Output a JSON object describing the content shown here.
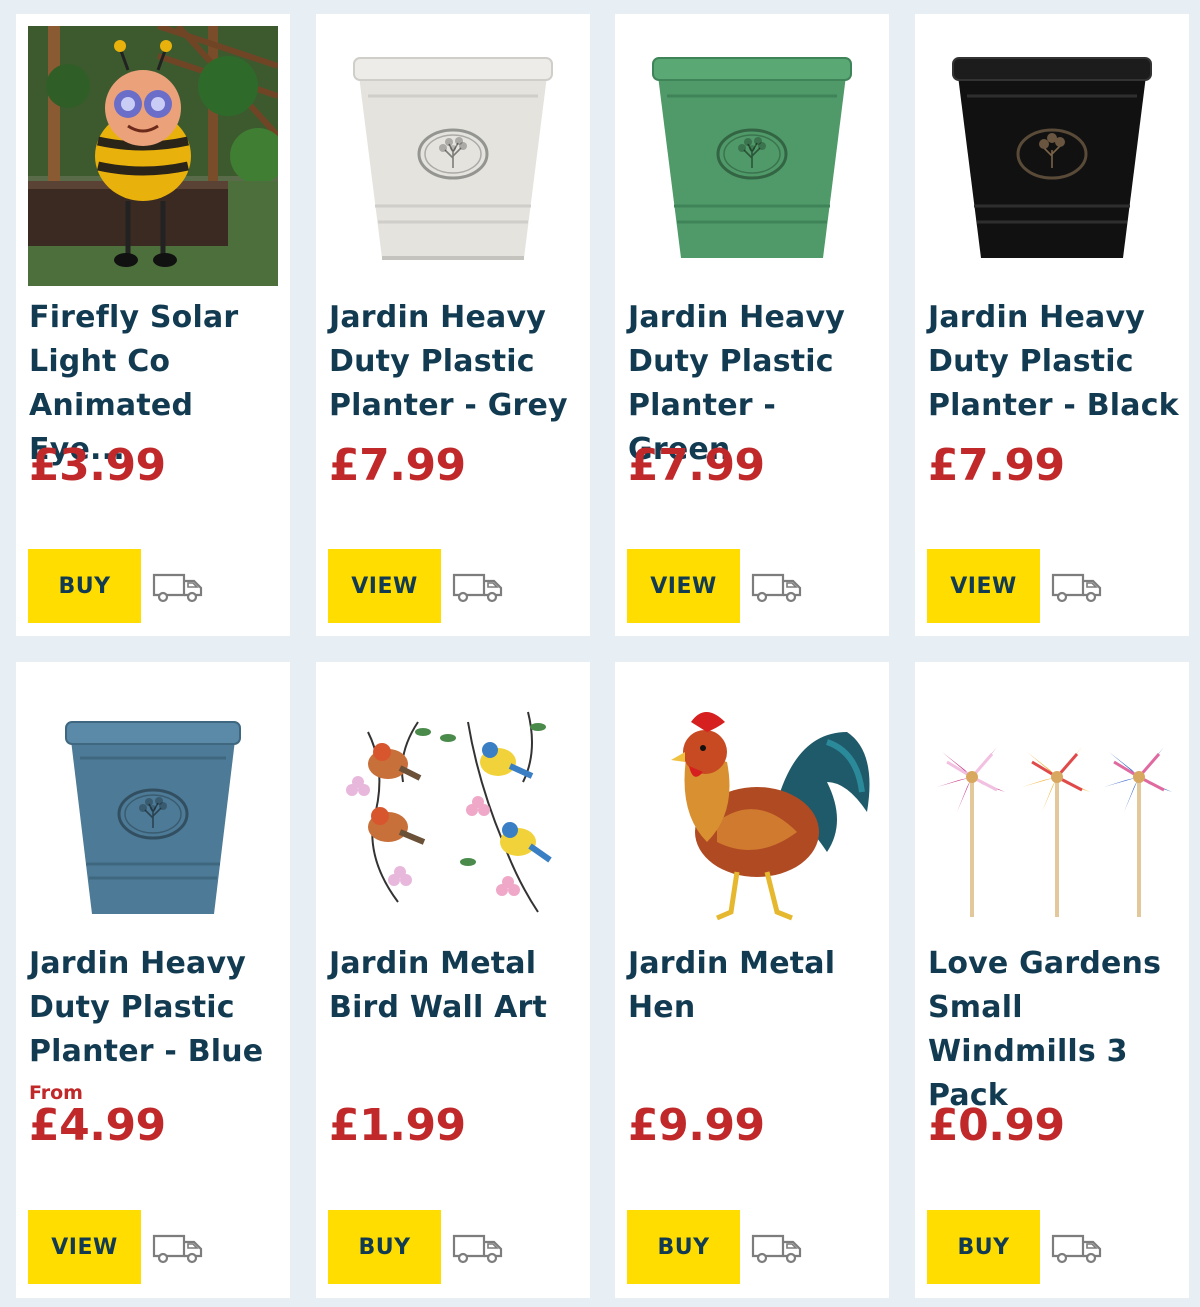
{
  "products": [
    {
      "title": "Firefly Solar Light Co Animated Eye...",
      "price": "£3.99",
      "from": "",
      "button": "BUY",
      "image_icon": "bee-solar-light-icon",
      "delivery_icon": "delivery-van-icon"
    },
    {
      "title": "Jardin Heavy Duty Plastic Planter - Grey",
      "price": "£7.99",
      "from": "",
      "button": "VIEW",
      "image_icon": "planter-icon",
      "color": "#e4e3de",
      "delivery_icon": "delivery-van-icon"
    },
    {
      "title": "Jardin Heavy Duty Plastic Planter - Green",
      "price": "£7.99",
      "from": "",
      "button": "VIEW",
      "image_icon": "planter-icon",
      "color": "#4f9a68",
      "delivery_icon": "delivery-van-icon"
    },
    {
      "title": "Jardin Heavy Duty Plastic Planter - Black",
      "price": "£7.99",
      "from": "",
      "button": "VIEW",
      "image_icon": "planter-icon",
      "color": "#111111",
      "delivery_icon": "delivery-van-icon"
    },
    {
      "title": "Jardin Heavy Duty Plastic Planter - Blue",
      "price": "£4.99",
      "from": "From",
      "button": "VIEW",
      "image_icon": "planter-icon",
      "color": "#4d7a96",
      "delivery_icon": "delivery-van-icon"
    },
    {
      "title": "Jardin Metal Bird Wall Art",
      "price": "£1.99",
      "from": "",
      "button": "BUY",
      "image_icon": "bird-wall-art-icon",
      "delivery_icon": "delivery-van-icon"
    },
    {
      "title": "Jardin Metal Hen",
      "price": "£9.99",
      "from": "",
      "button": "BUY",
      "image_icon": "metal-hen-icon",
      "delivery_icon": "delivery-van-icon"
    },
    {
      "title": "Love Gardens Small Windmills 3 Pack",
      "price": "£0.99",
      "from": "",
      "button": "BUY",
      "image_icon": "windmills-icon",
      "delivery_icon": "delivery-van-icon"
    }
  ],
  "colors": {
    "price": "#c0282a",
    "title": "#123b52",
    "button": "#ffdd00",
    "background": "#e7eef4"
  }
}
